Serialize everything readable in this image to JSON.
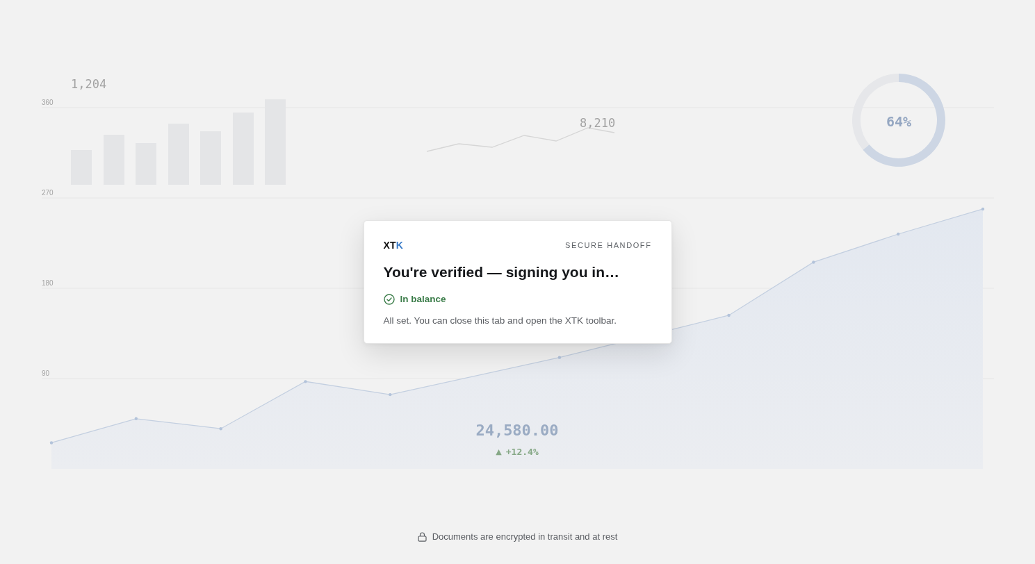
{
  "backdrop": {
    "bar_total": "1,204",
    "sparkline_value": "8,210",
    "ring": {
      "label": "64%",
      "chart_data": {
        "type": "donut",
        "values": [
          64,
          36
        ]
      }
    },
    "trend_chart": {
      "chart_data": {
        "type": "area",
        "values": [
          26,
          50,
          40,
          87,
          74,
          null,
          111,
          null,
          153,
          206,
          234,
          259
        ],
        "ylim": [
          0,
          360
        ],
        "yticks": [
          90,
          180,
          270,
          360
        ],
        "grid": true
      }
    },
    "balance": "24,580.00",
    "trend": {
      "arrow": "▲",
      "change": "+12.4%"
    }
  },
  "card": {
    "logo": [
      {
        "text": "XT",
        "accent": false
      },
      {
        "text": "K",
        "accent": true
      }
    ],
    "tag": "SECURE HANDOFF",
    "title": "You're verified — signing you in…",
    "status": "In balance",
    "message": "All set. You can close this tab and open the XTK toolbar."
  },
  "footer": {
    "text": "Documents are encrypted in transit and at rest"
  }
}
